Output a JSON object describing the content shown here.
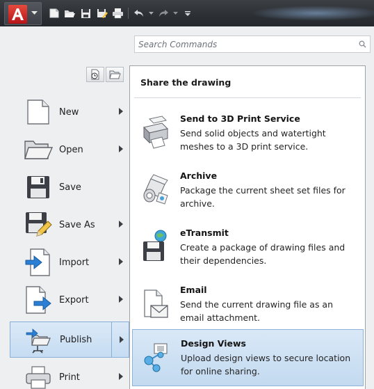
{
  "toolbar": {
    "icons": [
      "autocad-logo-icon",
      "new-icon",
      "open-icon",
      "save-icon",
      "save-as-icon",
      "print-icon",
      "undo-icon",
      "redo-icon",
      "customize-icon"
    ]
  },
  "search": {
    "placeholder": "Search Commands"
  },
  "menu": {
    "items": [
      {
        "label": "New",
        "icon": "new-file-icon",
        "has_submenu": true
      },
      {
        "label": "Open",
        "icon": "folder-icon",
        "has_submenu": true
      },
      {
        "label": "Save",
        "icon": "floppy-icon",
        "has_submenu": false
      },
      {
        "label": "Save As",
        "icon": "floppy-pencil-icon",
        "has_submenu": true
      },
      {
        "label": "Import",
        "icon": "import-icon",
        "has_submenu": true
      },
      {
        "label": "Export",
        "icon": "export-icon",
        "has_submenu": true
      },
      {
        "label": "Publish",
        "icon": "publish-icon",
        "has_submenu": true,
        "active": true
      },
      {
        "label": "Print",
        "icon": "printer-icon",
        "has_submenu": true
      }
    ]
  },
  "flyout": {
    "title": "Share the drawing",
    "entries": [
      {
        "title": "Send to 3D Print Service",
        "description": "Send solid objects and watertight meshes to a 3D print service.",
        "icon": "3d-printer-icon"
      },
      {
        "title": "Archive",
        "description": "Package the current sheet set files for archive.",
        "icon": "archive-icon"
      },
      {
        "title": "eTransmit",
        "description": "Create a package of drawing files and their dependencies.",
        "icon": "etransmit-icon"
      },
      {
        "title": "Email",
        "description": "Send the current drawing file as an email attachment.",
        "icon": "email-icon"
      },
      {
        "title": "Design Views",
        "description": "Upload design views to secure location for online sharing.",
        "icon": "design-views-icon",
        "selected": true
      }
    ]
  },
  "colors": {
    "titlebar": "#2d3035",
    "accent_red": "#c91e22",
    "highlight": "#c5dcf2",
    "highlight_border": "#86aed6",
    "arrow_blue": "#2a7fd4"
  }
}
